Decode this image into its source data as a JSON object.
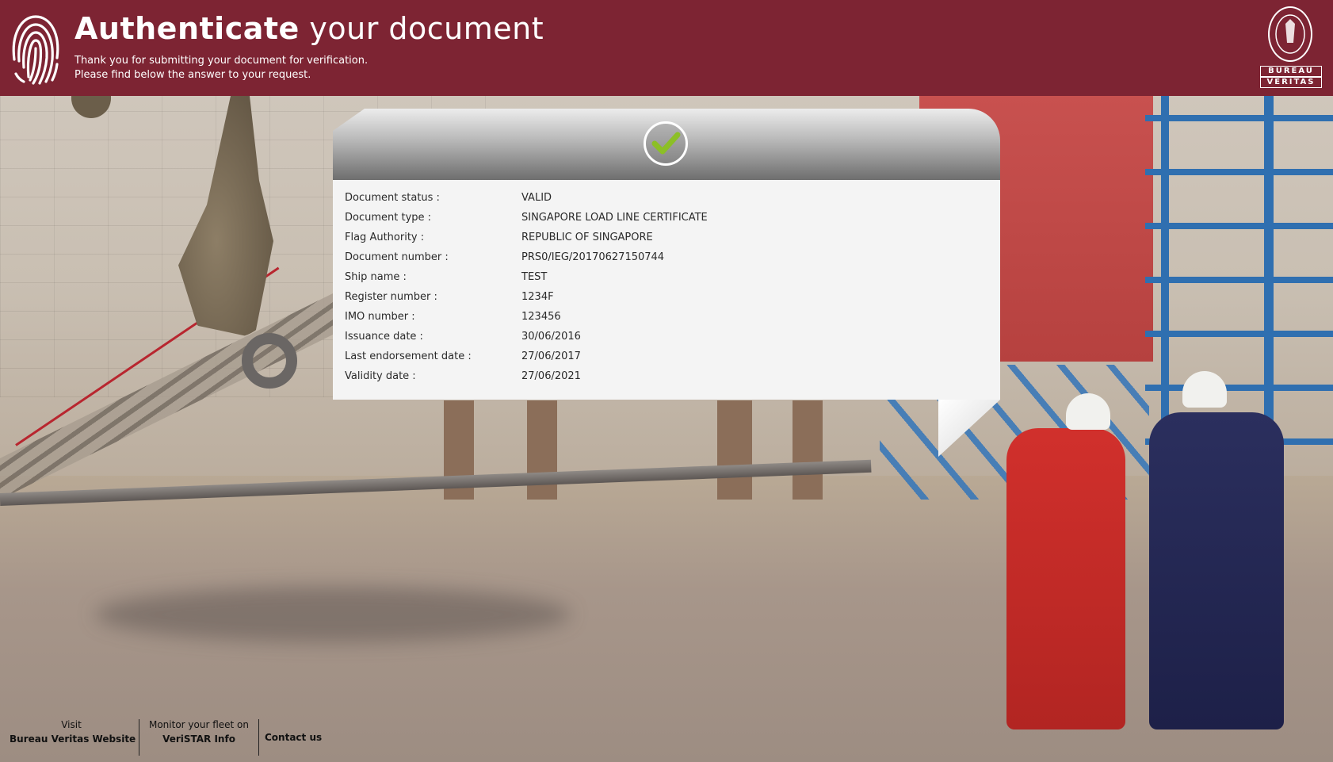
{
  "header": {
    "title_strong": "Authenticate",
    "title_rest": " your document",
    "subtitle_line1": "Thank you for submitting your document for verification.",
    "subtitle_line2": "Please find below the answer to your request.",
    "brand_line1": "BUREAU",
    "brand_line2": "VERITAS",
    "brand_color": "#7d2433"
  },
  "result": {
    "status_icon": "check-icon",
    "check_color": "#8cbf26",
    "rows": [
      {
        "label": "Document status :",
        "value": "VALID"
      },
      {
        "label": "Document type :",
        "value": "SINGAPORE LOAD LINE CERTIFICATE"
      },
      {
        "label": "Flag Authority :",
        "value": "REPUBLIC OF SINGAPORE"
      },
      {
        "label": "Document number :",
        "value": "PRS0/IEG/20170627150744"
      },
      {
        "label": "Ship name :",
        "value": "TEST"
      },
      {
        "label": "Register number :",
        "value": "1234F"
      },
      {
        "label": "IMO number :",
        "value": "123456"
      },
      {
        "label": "Issuance date :",
        "value": "30/06/2016"
      },
      {
        "label": "Last endorsement date :",
        "value": "27/06/2017"
      },
      {
        "label": "Validity date :",
        "value": "27/06/2021"
      }
    ]
  },
  "footer": {
    "visit_line1": "Visit",
    "visit_line2": "Bureau Veritas Website",
    "monitor_line1": "Monitor your fleet on",
    "monitor_line2": "VeriSTAR Info",
    "contact": "Contact us"
  }
}
